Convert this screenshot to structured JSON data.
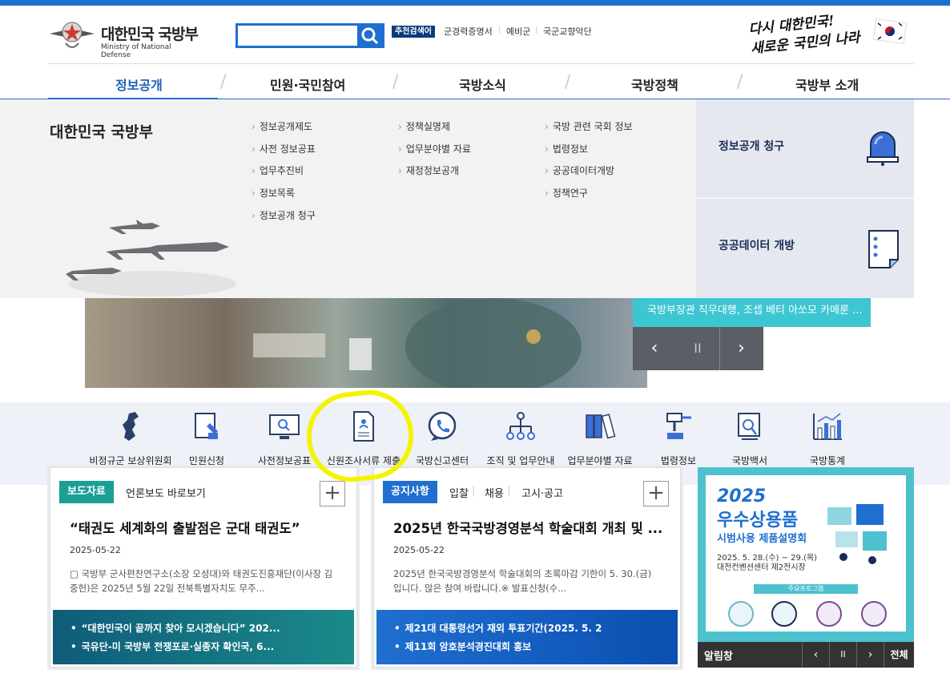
{
  "header": {
    "logo_title": "대한민국 국방부",
    "logo_subtitle": "Ministry of National Defense",
    "search_placeholder": "",
    "recommend_tag": "추천검색어",
    "keywords": [
      "군경력증명서",
      "예비군",
      "국군교향악단"
    ],
    "slogan_line1": "다시 대한민국!",
    "slogan_line2": "새로운 국민의 나라"
  },
  "gnb": [
    "정보공개",
    "민원·국민참여",
    "국방소식",
    "국방정책",
    "국방부 소개"
  ],
  "mega": {
    "title": "대한민국 국방부",
    "col1": [
      "정보공개제도",
      "사전 정보공표",
      "업무추진비",
      "정보목록",
      "정보공개 청구"
    ],
    "col2": [
      "정책실명제",
      "업무분야별 자료",
      "재정정보공개"
    ],
    "col3": [
      "국방 관련 국회 정보",
      "법령정보",
      "공공데이터개방",
      "정책연구"
    ],
    "right_top": "정보공개 청구",
    "right_bottom": "공공데이터 개방"
  },
  "hero": {
    "caption": "국방부장관 직무대행, 조셉 베티 아쏘모 카메룬 ...",
    "prev": "‹",
    "pause": "II",
    "next": "›"
  },
  "quick": [
    {
      "label": "비정규군 보상위원회",
      "icon": "korea-map-icon"
    },
    {
      "label": "민원신청",
      "icon": "form-pen-icon"
    },
    {
      "label": "사전정보공표",
      "icon": "monitor-search-icon"
    },
    {
      "label": "신원조사서류 제출",
      "icon": "document-person-icon"
    },
    {
      "label": "국방신고센터",
      "icon": "phone-bubble-icon"
    },
    {
      "label": "조직 및 업무안내",
      "icon": "org-chart-icon"
    },
    {
      "label": "업무분야별 자료",
      "icon": "binders-icon"
    },
    {
      "label": "법령정보",
      "icon": "gavel-icon"
    },
    {
      "label": "국방백서",
      "icon": "book-search-icon"
    },
    {
      "label": "국방통계",
      "icon": "bar-chart-icon"
    }
  ],
  "panel1": {
    "tab_active": "보도자료",
    "tab2": "언론보도 바로보기",
    "plus": "+",
    "headline": "“태권도 세계화의 출발점은 군대 태권도”",
    "date": "2025-05-22",
    "body": "□ 국방부 군사편찬연구소(소장 오성대)와 태권도진흥재단(이사장 김중헌)은 2025년 5월 22일 전북특별자치도 무주...",
    "links": [
      "“대한민국이 끝까지 찾아 모시겠습니다” 202...",
      "국유단-미 국방부 전쟁포로·실종자 확인국, 6..."
    ]
  },
  "panel2": {
    "tab_active": "공지사항",
    "tabs": [
      "입찰",
      "채용",
      "고시·공고"
    ],
    "plus": "+",
    "headline": "2025년 한국국방경영분석 학술대회 개최 및 ...",
    "date": "2025-05-22",
    "body": "2025년 한국국방경영분석 학술대회의 초록마감 기한이 5. 30.(금) 입니다. 많은 참여 바랍니다.※ 발표신청(수...",
    "links": [
      "제21대 대통령선거 재외 투표기간(2025. 5. 2",
      "제11회 암호분석경진대회 홍보"
    ]
  },
  "banner": {
    "year": "2025",
    "title": "우수상용품",
    "subtitle": "시범사용 제품설명회",
    "date": "2025. 5. 28.(수) ~ 29.(목)",
    "place": "대전컨벤션센터 제2전시장",
    "program": "주요프로그램",
    "alarm_label": "알림창",
    "ctrl_prev": "‹",
    "ctrl_pause": "II",
    "ctrl_next": "›",
    "ctrl_all": "전체"
  },
  "colors": {
    "accent": "#1f6fd0",
    "teal": "#1a9e96",
    "navy": "#0b3a7e",
    "banner": "#4ec1cf",
    "highlight": "#f4f400"
  }
}
